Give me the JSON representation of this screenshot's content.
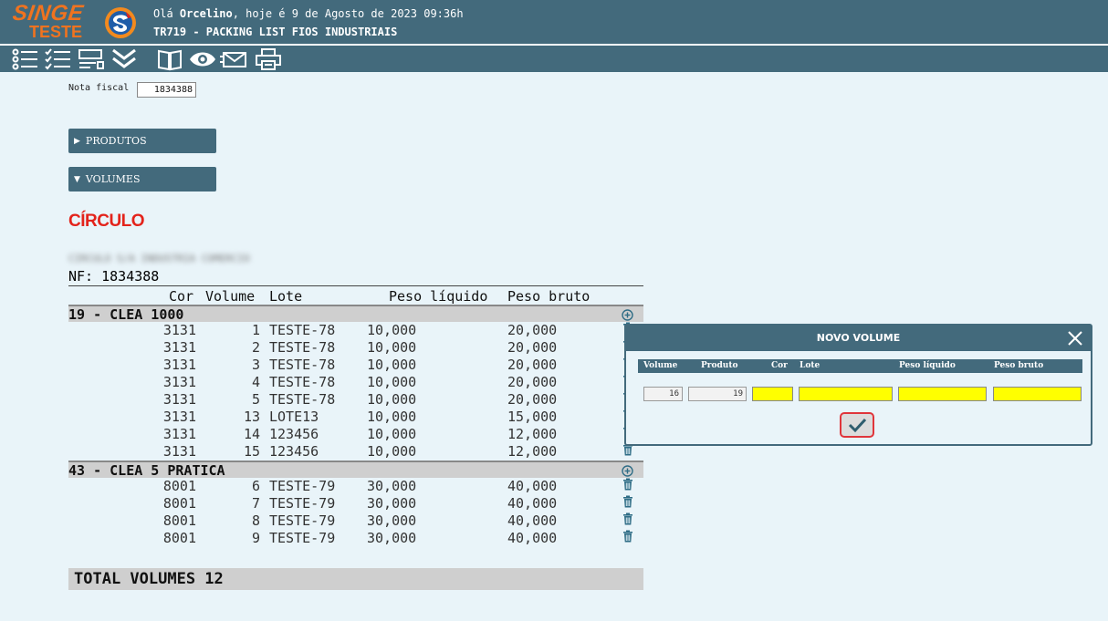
{
  "header": {
    "logo_top": "SINGE",
    "logo_bottom": "TESTE",
    "greeting_prefix": "Olá ",
    "user_name": "Orcelino",
    "greeting_suffix": ", hoje é 9 de Agosto de 2023 09:36h",
    "screen_title": "TR719 - PACKING LIST FIOS INDUSTRIAIS"
  },
  "toolbar": {
    "icons": [
      "list-icon",
      "checklist-icon",
      "form-icon",
      "double-chevron-down-icon",
      "book-icon",
      "eye-icon",
      "mail-icon",
      "printer-icon"
    ]
  },
  "form": {
    "nf_label": "Nota fiscal",
    "nf_value": "1834388"
  },
  "sections": {
    "produtos": "PRODUTOS",
    "volumes": "VOLUMES",
    "produtos_arrow": "▶",
    "volumes_arrow": "▼"
  },
  "report": {
    "brand": "CÍRCULO",
    "company_blurred": "CIRCULO S/A INDUSTRIA COMERCIO",
    "nf_line": "NF: 1834388",
    "columns": {
      "cor": "Cor",
      "volume": "Volume",
      "lote": "Lote",
      "peso_liquido": "Peso líquido",
      "peso_bruto": "Peso bruto"
    },
    "groups": [
      {
        "name": "19 - CLEA 1000",
        "rows": [
          {
            "cor": "3131",
            "volume": "1",
            "lote": "TESTE-78",
            "pl": "10,000",
            "pb": "20,000"
          },
          {
            "cor": "3131",
            "volume": "2",
            "lote": "TESTE-78",
            "pl": "10,000",
            "pb": "20,000"
          },
          {
            "cor": "3131",
            "volume": "3",
            "lote": "TESTE-78",
            "pl": "10,000",
            "pb": "20,000"
          },
          {
            "cor": "3131",
            "volume": "4",
            "lote": "TESTE-78",
            "pl": "10,000",
            "pb": "20,000"
          },
          {
            "cor": "3131",
            "volume": "5",
            "lote": "TESTE-78",
            "pl": "10,000",
            "pb": "20,000"
          },
          {
            "cor": "3131",
            "volume": "13",
            "lote": "LOTE13",
            "pl": "10,000",
            "pb": "15,000"
          },
          {
            "cor": "3131",
            "volume": "14",
            "lote": "123456",
            "pl": "10,000",
            "pb": "12,000"
          },
          {
            "cor": "3131",
            "volume": "15",
            "lote": "123456",
            "pl": "10,000",
            "pb": "12,000"
          }
        ]
      },
      {
        "name": "43 - CLEA 5 PRATICA",
        "rows": [
          {
            "cor": "8001",
            "volume": "6",
            "lote": "TESTE-79",
            "pl": "30,000",
            "pb": "40,000"
          },
          {
            "cor": "8001",
            "volume": "7",
            "lote": "TESTE-79",
            "pl": "30,000",
            "pb": "40,000"
          },
          {
            "cor": "8001",
            "volume": "8",
            "lote": "TESTE-79",
            "pl": "30,000",
            "pb": "40,000"
          },
          {
            "cor": "8001",
            "volume": "9",
            "lote": "TESTE-79",
            "pl": "30,000",
            "pb": "40,000"
          }
        ]
      }
    ],
    "total": "TOTAL VOLUMES 12"
  },
  "modal": {
    "title": "NOVO VOLUME",
    "columns": {
      "volume": "Volume",
      "produto": "Produto",
      "cor": "Cor",
      "lote": "Lote",
      "peso_liquido": "Peso líquido",
      "peso_bruto": "Peso bruto"
    },
    "values": {
      "volume": "16",
      "produto": "19",
      "cor": "",
      "lote": "",
      "peso_liquido": "",
      "peso_bruto": ""
    }
  },
  "colors": {
    "header_bg": "#436a7c",
    "page_bg": "#e9f4f9",
    "brand_orange": "#f0731f",
    "brand_red": "#e3231b",
    "input_highlight": "#ffff00",
    "confirm_border": "#e0353b"
  }
}
